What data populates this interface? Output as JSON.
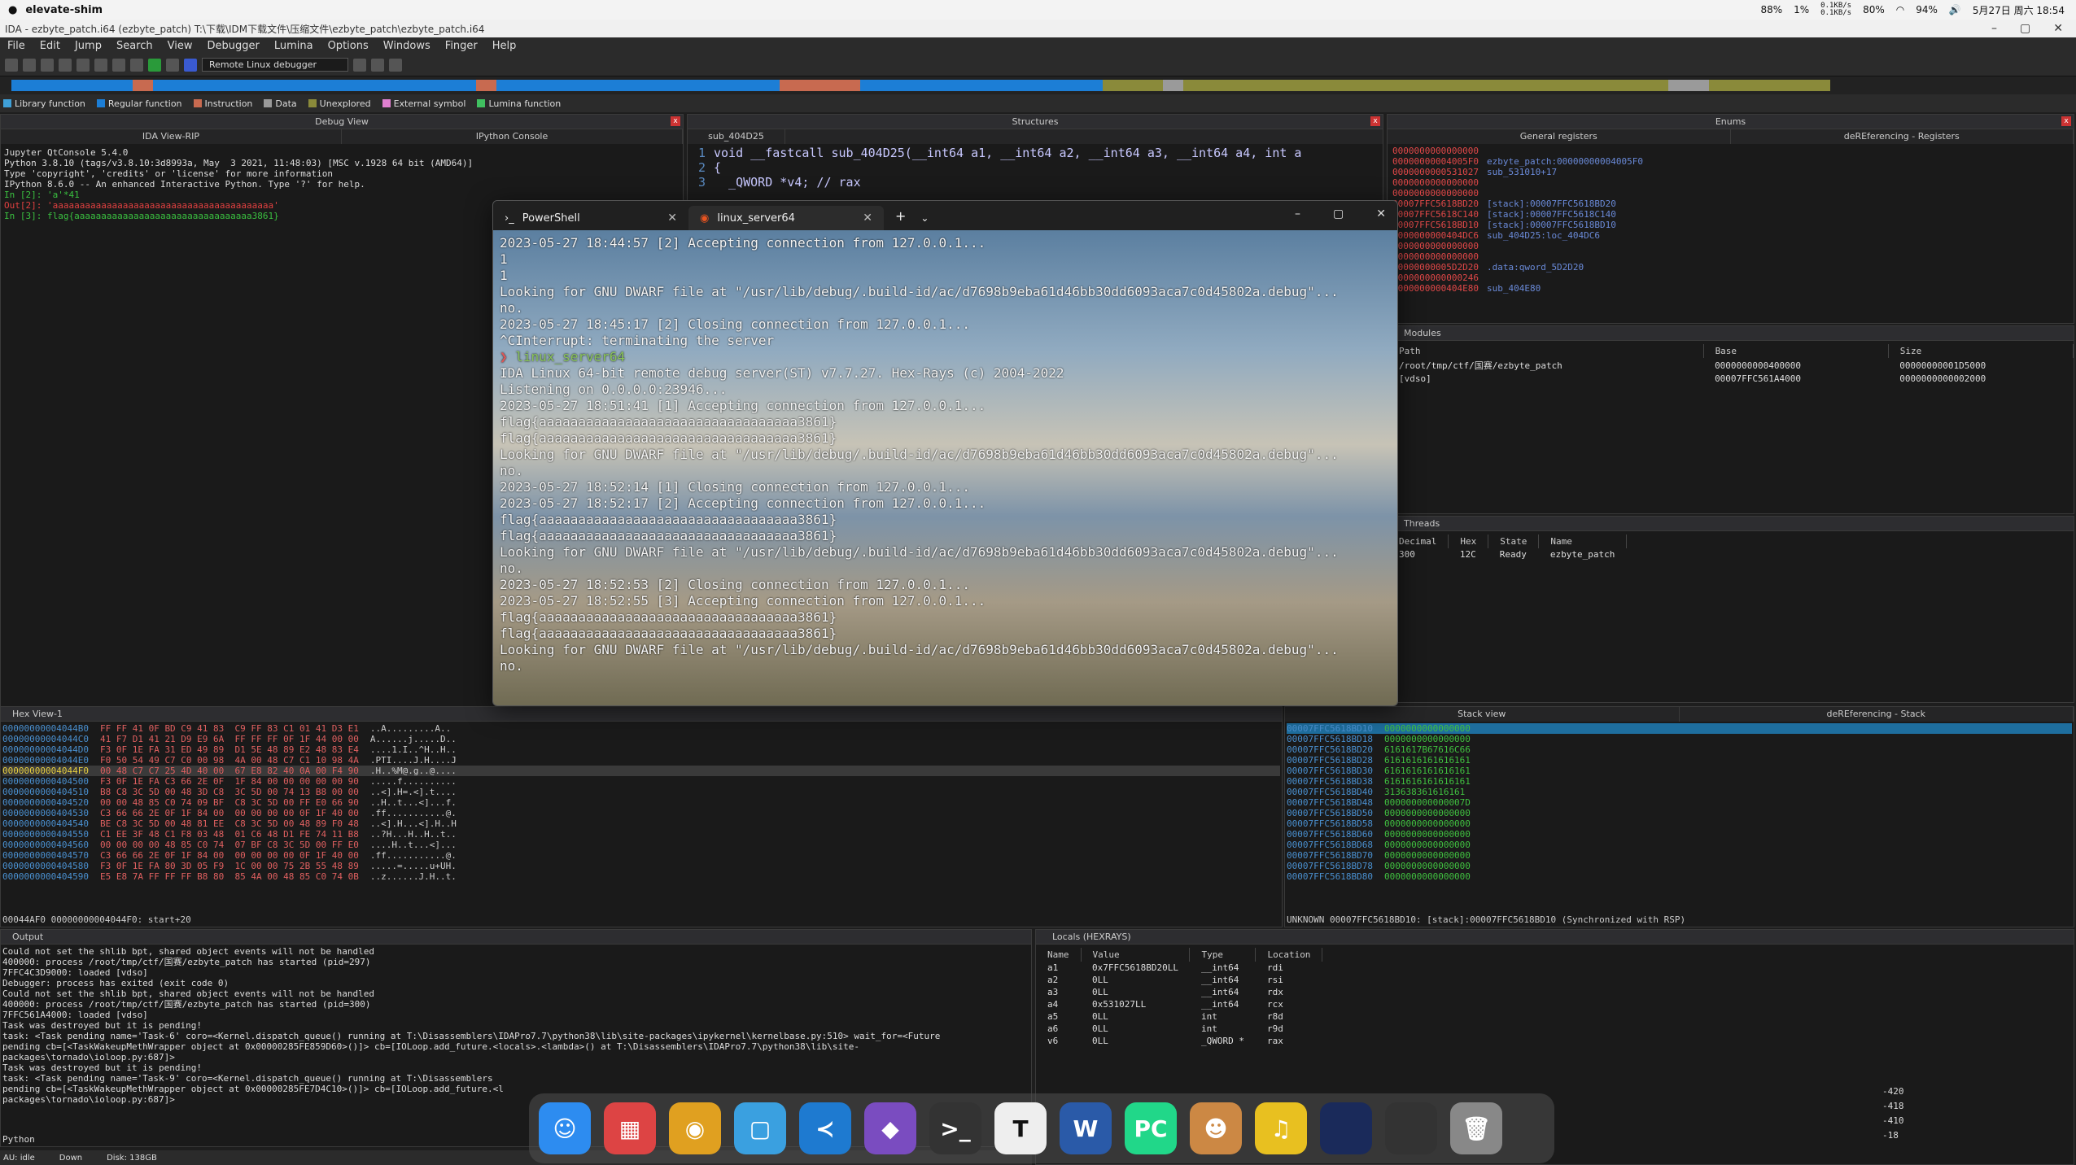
{
  "sysbar": {
    "app_name": "elevate-shim",
    "battery1": "88%",
    "cpu": "1%",
    "net_up": "0.1KB/s",
    "net_down": "0.1KB/s",
    "mem": "80%",
    "wifi_level": "94%",
    "datetime": "5月27日 周六 18:54"
  },
  "ida_title": "IDA - ezbyte_patch.i64 (ezbyte_patch) T:\\下载\\IDM下载文件\\压缩文件\\ezbyte_patch\\ezbyte_patch.i64",
  "menu": [
    "File",
    "Edit",
    "Jump",
    "Search",
    "View",
    "Debugger",
    "Lumina",
    "Options",
    "Windows",
    "Finger",
    "Help"
  ],
  "debugger_select": "Remote Linux debugger",
  "legend": [
    {
      "label": "Library function",
      "color": "#3fa0d8"
    },
    {
      "label": "Regular function",
      "color": "#1c7ed6"
    },
    {
      "label": "Instruction",
      "color": "#c86a50"
    },
    {
      "label": "Data",
      "color": "#9a9a9a"
    },
    {
      "label": "Unexplored",
      "color": "#8a8a3a"
    },
    {
      "label": "External symbol",
      "color": "#e07fd0"
    },
    {
      "label": "Lumina function",
      "color": "#40c060"
    }
  ],
  "colors": {
    "regular": "#1c7ed6",
    "instruction": "#c86a50",
    "unexplored": "#8a8a3a",
    "data": "#9a9a9a"
  },
  "panes": {
    "debug_view": "Debug View",
    "ida_view": "IDA View-RIP",
    "ipython": "IPython Console",
    "structures": "Structures",
    "pseudocode": "sub_404D25",
    "enums": "Enums",
    "gen_regs": "General registers",
    "deref_regs": "deREferencing - Registers",
    "modules": "Modules",
    "threads": "Threads",
    "hex_view": "Hex View-1",
    "stack_view": "Stack view",
    "deref_stack": "deREferencing - Stack",
    "output": "Output",
    "locals": "Locals (HEXRAYS)"
  },
  "ipython_lines": [
    "Jupyter QtConsole 5.4.0",
    "Python 3.8.10 (tags/v3.8.10:3d8993a, May  3 2021, 11:48:03) [MSC v.1928 64 bit (AMD64)]",
    "Type 'copyright', 'credits' or 'license' for more information",
    "IPython 8.6.0 -- An enhanced Interactive Python. Type '?' for help.",
    "",
    "In [2]: 'a'*41",
    "Out[2]: 'aaaaaaaaaaaaaaaaaaaaaaaaaaaaaaaaaaaaaaaaa'",
    "",
    "In [3]: flag{aaaaaaaaaaaaaaaaaaaaaaaaaaaaaaaaa3861}"
  ],
  "pseudocode_lines": [
    {
      "n": "1",
      "t": "void __fastcall sub_404D25(__int64 a1, __int64 a2, __int64 a3, __int64 a4, int a"
    },
    {
      "n": "2",
      "t": "{"
    },
    {
      "n": "3",
      "t": "  _QWORD *v4; // rax"
    }
  ],
  "registers": [
    {
      "v": "0000000000000000",
      "d": ""
    },
    {
      "v": "00000000004005F0",
      "d": "ezbyte_patch:00000000004005F0"
    },
    {
      "v": "0000000000531027",
      "d": "sub_531010+17"
    },
    {
      "v": "0000000000000000",
      "d": ""
    },
    {
      "v": "0000000000000000",
      "d": ""
    },
    {
      "v": "00007FFC5618BD20",
      "d": "[stack]:00007FFC5618BD20"
    },
    {
      "v": "00007FFC5618C140",
      "d": "[stack]:00007FFC5618C140"
    },
    {
      "v": "00007FFC5618BD10",
      "d": "[stack]:00007FFC5618BD10"
    },
    {
      "v": "0000000000404DC6",
      "d": "sub_404D25:loc_404DC6"
    },
    {
      "v": "0000000000000000",
      "d": ""
    },
    {
      "v": "0000000000000000",
      "d": ""
    },
    {
      "v": "00000000005D2D20",
      "d": ".data:qword_5D2D20"
    },
    {
      "v": "0000000000000246",
      "d": ""
    },
    {
      "v": "0000000000404E80",
      "d": "sub_404E80"
    }
  ],
  "modules": {
    "headers": [
      "Path",
      "Base",
      "Size"
    ],
    "rows": [
      [
        "/root/tmp/ctf/国赛/ezbyte_patch",
        "0000000000400000",
        "00000000001D5000"
      ],
      [
        "[vdso]",
        "00007FFC561A4000",
        "0000000000002000"
      ]
    ]
  },
  "threads": {
    "headers": [
      "Decimal",
      "Hex",
      "State",
      "Name"
    ],
    "rows": [
      [
        "300",
        "12C",
        "Ready",
        "ezbyte_patch"
      ]
    ]
  },
  "hex_rows": [
    {
      "a": "00000000004044B0",
      "h": "FF FF 41 0F BD C9 41 83  C9 FF 83 C1 01 41 D3 E1",
      "s": "..A.........A.."
    },
    {
      "a": "00000000004044C0",
      "h": "41 F7 D1 41 21 D9 E9 6A  FF FF FF 0F 1F 44 00 00",
      "s": "A......j.....D.."
    },
    {
      "a": "00000000004044D0",
      "h": "F3 0F 1E FA 31 ED 49 89  D1 5E 48 89 E2 48 83 E4",
      "s": "....1.I..^H..H.."
    },
    {
      "a": "00000000004044E0",
      "h": "F0 50 54 49 C7 C0 00 98  4A 00 48 C7 C1 10 98 4A",
      "s": ".PTI....J.H....J"
    },
    {
      "a": "00000000004044F0",
      "h": "00 48 C7 C7 25 4D 40 00  67 E8 82 40 0A 00 F4 90",
      "s": ".H..%M@.g..@...."
    },
    {
      "a": "0000000000404500",
      "h": "F3 0F 1E FA C3 66 2E 0F  1F 84 00 00 00 00 00 90",
      "s": ".....f.........."
    },
    {
      "a": "0000000000404510",
      "h": "B8 C8 3C 5D 00 48 3D C8  3C 5D 00 74 13 B8 00 00",
      "s": "..<].H=.<].t...."
    },
    {
      "a": "0000000000404520",
      "h": "00 00 48 85 C0 74 09 BF  C8 3C 5D 00 FF E0 66 90",
      "s": "..H..t...<]...f."
    },
    {
      "a": "0000000000404530",
      "h": "C3 66 66 2E 0F 1F 84 00  00 00 00 00 0F 1F 40 00",
      "s": ".ff...........@."
    },
    {
      "a": "0000000000404540",
      "h": "BE C8 3C 5D 00 48 81 EE  C8 3C 5D 00 48 89 F0 48",
      "s": "..<].H...<].H..H"
    },
    {
      "a": "0000000000404550",
      "h": "C1 EE 3F 48 C1 F8 03 48  01 C6 48 D1 FE 74 11 B8",
      "s": "..?H...H..H..t.."
    },
    {
      "a": "0000000000404560",
      "h": "00 00 00 00 48 85 C0 74  07 BF C8 3C 5D 00 FF E0",
      "s": "....H..t...<]..."
    },
    {
      "a": "0000000000404570",
      "h": "C3 66 66 2E 0F 1F 84 00  00 00 00 00 0F 1F 40 00",
      "s": ".ff...........@."
    },
    {
      "a": "0000000000404580",
      "h": "F3 0F 1E FA 80 3D 05 F9  1C 00 00 75 2B 55 48 89",
      "s": ".....=.....u+UH."
    },
    {
      "a": "0000000000404590",
      "h": "E5 E8 7A FF FF FF B8 80  85 4A 00 48 85 C0 74 0B",
      "s": "..z......J.H..t."
    }
  ],
  "hex_status": "00044AF0 00000000004044F0: start+20",
  "stack_rows": [
    {
      "a": "00007FFC5618BD10",
      "v": "0000000000000000"
    },
    {
      "a": "00007FFC5618BD18",
      "v": "0000000000000000"
    },
    {
      "a": "00007FFC5618BD20",
      "v": "6161617B67616C66"
    },
    {
      "a": "00007FFC5618BD28",
      "v": "6161616161616161"
    },
    {
      "a": "00007FFC5618BD30",
      "v": "6161616161616161"
    },
    {
      "a": "00007FFC5618BD38",
      "v": "6161616161616161"
    },
    {
      "a": "00007FFC5618BD40",
      "v": "313638361616161"
    },
    {
      "a": "00007FFC5618BD48",
      "v": "000000000000007D"
    },
    {
      "a": "00007FFC5618BD50",
      "v": "0000000000000000"
    },
    {
      "a": "00007FFC5618BD58",
      "v": "0000000000000000"
    },
    {
      "a": "00007FFC5618BD60",
      "v": "0000000000000000"
    },
    {
      "a": "00007FFC5618BD68",
      "v": "0000000000000000"
    },
    {
      "a": "00007FFC5618BD70",
      "v": "0000000000000000"
    },
    {
      "a": "00007FFC5618BD78",
      "v": "0000000000000000"
    },
    {
      "a": "00007FFC5618BD80",
      "v": "0000000000000000"
    }
  ],
  "stack_status": "UNKNOWN 00007FFC5618BD10: [stack]:00007FFC5618BD10 (Synchronized with RSP)",
  "output_lines": [
    "Could not set the shlib bpt, shared object events will not be handled",
    "400000: process /root/tmp/ctf/国赛/ezbyte_patch has started (pid=297)",
    "7FFC4C3D9000: loaded [vdso]",
    "Debugger: process has exited (exit code 0)",
    "Could not set the shlib bpt, shared object events will not be handled",
    "400000: process /root/tmp/ctf/国赛/ezbyte_patch has started (pid=300)",
    "7FFC561A4000: loaded [vdso]",
    "Task was destroyed but it is pending!",
    "task: <Task pending name='Task-6' coro=<Kernel.dispatch_queue() running at T:\\Disassemblers\\IDAPro7.7\\python38\\lib\\site-packages\\ipykernel\\kernelbase.py:510> wait_for=<Future",
    "pending cb=[<TaskWakeupMethWrapper object at 0x00000285FE859D60>()]> cb=[IOLoop.add_future.<locals>.<lambda>() at T:\\Disassemblers\\IDAPro7.7\\python38\\lib\\site-",
    "packages\\tornado\\ioloop.py:687]>",
    "Task was destroyed but it is pending!",
    "task: <Task pending name='Task-9' coro=<Kernel.dispatch_queue() running at T:\\Disassemblers",
    "pending cb=[<TaskWakeupMethWrapper object at 0x00000285FE7D4C10>()]> cb=[IOLoop.add_future.<l",
    "packages\\tornado\\ioloop.py:687]>"
  ],
  "output_footer": "Python",
  "status_bar": [
    "AU: idle",
    "Down",
    "Disk: 138GB"
  ],
  "locals": {
    "headers": [
      "Name",
      "Value",
      "Type",
      "Location"
    ],
    "rows": [
      [
        "a1",
        "0x7FFC5618BD20LL",
        "__int64",
        "rdi"
      ],
      [
        "a2",
        "0LL",
        "__int64",
        "rsi"
      ],
      [
        "a3",
        "0LL",
        "__int64",
        "rdx"
      ],
      [
        "a4",
        "0x531027LL",
        "__int64",
        "rcx"
      ],
      [
        "a5",
        "0LL",
        "int",
        "r8d"
      ],
      [
        "a6",
        "0LL",
        "int",
        "r9d"
      ],
      [
        "v6",
        "0LL",
        "_QWORD *",
        "rax"
      ]
    ],
    "extra": [
      "-420",
      "-418",
      "-410",
      "-18"
    ]
  },
  "terminal": {
    "tabs": [
      {
        "label": "PowerShell"
      },
      {
        "label": "linux_server64"
      }
    ],
    "lines": [
      "2023-05-27 18:44:57 [2] Accepting connection from 127.0.0.1...",
      "1",
      "1",
      "Looking for GNU DWARF file at \"/usr/lib/debug/.build-id/ac/d7698b9eba61d46bb30dd6093aca7c0d45802a.debug\"...",
      "no.",
      "2023-05-27 18:45:17 [2] Closing connection from 127.0.0.1...",
      "^CInterrupt: terminating the server"
    ],
    "prompt_symbol": "❯",
    "prompt_cmd": "linux_server64",
    "lines2": [
      "IDA Linux 64-bit remote debug server(ST) v7.7.27. Hex-Rays (c) 2004-2022",
      "Listening on 0.0.0.0:23946...",
      "2023-05-27 18:51:41 [1] Accepting connection from 127.0.0.1...",
      "flag{aaaaaaaaaaaaaaaaaaaaaaaaaaaaaaaaa3861}",
      "flag{aaaaaaaaaaaaaaaaaaaaaaaaaaaaaaaaa3861}",
      "Looking for GNU DWARF file at \"/usr/lib/debug/.build-id/ac/d7698b9eba61d46bb30dd6093aca7c0d45802a.debug\"...",
      "no.",
      "2023-05-27 18:52:14 [1] Closing connection from 127.0.0.1...",
      "2023-05-27 18:52:17 [2] Accepting connection from 127.0.0.1...",
      "flag{aaaaaaaaaaaaaaaaaaaaaaaaaaaaaaaaa3861}",
      "flag{aaaaaaaaaaaaaaaaaaaaaaaaaaaaaaaaa3861}",
      "Looking for GNU DWARF file at \"/usr/lib/debug/.build-id/ac/d7698b9eba61d46bb30dd6093aca7c0d45802a.debug\"...",
      "no.",
      "2023-05-27 18:52:53 [2] Closing connection from 127.0.0.1...",
      "2023-05-27 18:52:55 [3] Accepting connection from 127.0.0.1...",
      "flag{aaaaaaaaaaaaaaaaaaaaaaaaaaaaaaaaa3861}",
      "flag{aaaaaaaaaaaaaaaaaaaaaaaaaaaaaaaaa3861}",
      "Looking for GNU DWARF file at \"/usr/lib/debug/.build-id/ac/d7698b9eba61d46bb30dd6093aca7c0d45802a.debug\"...",
      "no."
    ]
  },
  "dock": [
    {
      "name": "finder",
      "glyph": "☺",
      "color": "#2d8cf0"
    },
    {
      "name": "launchpad",
      "glyph": "▦",
      "color": "#d44"
    },
    {
      "name": "chrome",
      "glyph": "◉",
      "color": "#e0a020"
    },
    {
      "name": "preview",
      "glyph": "▢",
      "color": "#3aa0e0"
    },
    {
      "name": "vscode",
      "glyph": "≺",
      "color": "#1e7ad0"
    },
    {
      "name": "obsidian",
      "glyph": "◆",
      "color": "#7a4cc0"
    },
    {
      "name": "terminal",
      "glyph": ">_",
      "color": "#333"
    },
    {
      "name": "typora",
      "glyph": "T",
      "color": "#eee"
    },
    {
      "name": "word",
      "glyph": "W",
      "color": "#2a5aa8"
    },
    {
      "name": "pycharm",
      "glyph": "PC",
      "color": "#21d789"
    },
    {
      "name": "avatar-app",
      "glyph": "☻",
      "color": "#c84"
    },
    {
      "name": "music",
      "glyph": "♫",
      "color": "#e8c020"
    },
    {
      "name": "window-thumb-1",
      "glyph": "",
      "color": "#1a2a5a"
    },
    {
      "name": "window-thumb-2",
      "glyph": "",
      "color": "#333"
    },
    {
      "name": "trash",
      "glyph": "🗑",
      "color": "#888"
    }
  ]
}
